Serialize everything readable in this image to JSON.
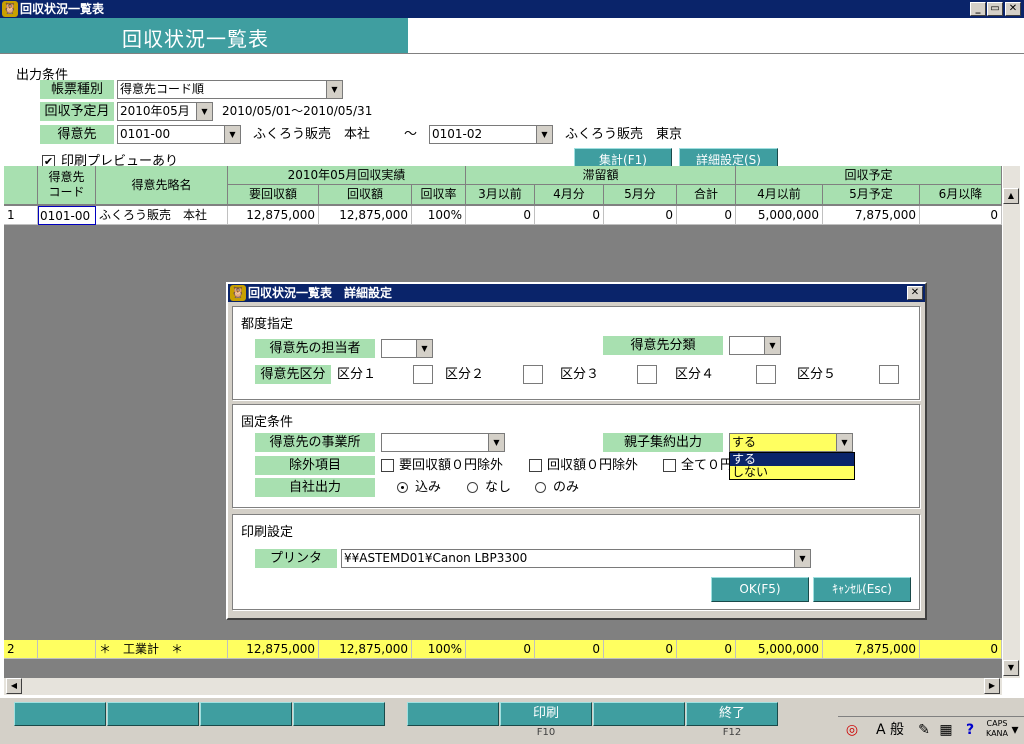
{
  "window": {
    "title": "回収状況一覧表",
    "min": "_",
    "max": "▭",
    "close": "✕"
  },
  "banner": {
    "title": "回収状況一覧表"
  },
  "conditions": {
    "heading": "出力条件",
    "report_type": {
      "label": "帳票種別",
      "value": "得意先コード順"
    },
    "due_month": {
      "label": "回収予定月",
      "value": "2010年05月",
      "range": "2010/05/01〜2010/05/31"
    },
    "customer": {
      "label": "得意先",
      "from_value": "0101-00",
      "from_name": "ふくろう販売　本社",
      "tilde": "〜",
      "to_value": "0101-02",
      "to_name": "ふくろう販売　東京"
    },
    "preview": {
      "label": "印刷プレビューあり",
      "checked": "✔"
    },
    "btn_total": "集計(F1)",
    "btn_detail": "詳細設定(S)"
  },
  "grid": {
    "headers": {
      "code": "得意先\nコード",
      "name": "得意先略名",
      "group_actual": "2010年05月回収実績",
      "group_balance": "滞留額",
      "group_plan": "回収予定",
      "cols": [
        "要回収額",
        "回収額",
        "回収率",
        "3月以前",
        "4月分",
        "5月分",
        "合計",
        "4月以前",
        "5月予定",
        "6月以降"
      ]
    },
    "rows": [
      {
        "no": "1",
        "code": "0101-00",
        "name": "ふくろう販売　本社",
        "cells": [
          "12,875,000",
          "12,875,000",
          "100%",
          "0",
          "0",
          "0",
          "0",
          "5,000,000",
          "7,875,000",
          "0"
        ]
      }
    ],
    "total": {
      "no": "2",
      "name": "＊　工業計　＊",
      "cells": [
        "12,875,000",
        "12,875,000",
        "100%",
        "0",
        "0",
        "0",
        "0",
        "5,000,000",
        "7,875,000",
        "0"
      ]
    }
  },
  "dialog": {
    "title": "回収状況一覧表　詳細設定",
    "each": {
      "heading": "都度指定",
      "staff_label": "得意先の担当者",
      "category_label": "得意先分類",
      "division_label": "得意先区分",
      "divisions": [
        "区分１",
        "区分２",
        "区分３",
        "区分４",
        "区分５"
      ]
    },
    "fixed": {
      "heading": "固定条件",
      "office_label": "得意先の事業所",
      "parent_label": "親子集約出力",
      "parent_value": "する",
      "parent_options": [
        "する",
        "しない"
      ],
      "exclude_label": "除外項目",
      "exclude_items": [
        "要回収額０円除外",
        "回収額０円除外",
        "全て０円"
      ],
      "own_label": "自社出力",
      "own_options": [
        "込み",
        "なし",
        "のみ"
      ]
    },
    "print": {
      "heading": "印刷設定",
      "printer_label": "プリンタ",
      "printer_value": "¥¥ASTEMD01¥Canon LBP3300"
    },
    "ok": "OK(F5)",
    "cancel": "ｷｬﾝｾﾙ(Esc)"
  },
  "fkeys": [
    {
      "label": "",
      "cap": ""
    },
    {
      "label": "",
      "cap": ""
    },
    {
      "label": "",
      "cap": ""
    },
    {
      "label": "",
      "cap": ""
    },
    {
      "label": "",
      "cap": ""
    },
    {
      "label": "印刷",
      "cap": "F10"
    },
    {
      "label": "",
      "cap": ""
    },
    {
      "label": "終了",
      "cap": "F12"
    }
  ],
  "tray": {
    "ime": "A 般",
    "caps": "CAPS",
    "kana": "KANA"
  },
  "colors": {
    "accent": "#3f9ea0",
    "label_bg": "#a8e0b0",
    "total_row": "#ffff60",
    "titlebar": "#0a246a"
  }
}
